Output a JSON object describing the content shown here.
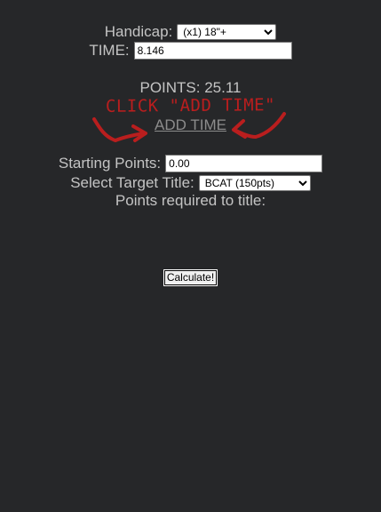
{
  "handicap": {
    "label": "Handicap:",
    "selected": "(x1) 18\"+"
  },
  "time": {
    "label": "TIME:",
    "value": "8.146"
  },
  "points": {
    "label": "POINTS: 25.11"
  },
  "hint": {
    "text": "CLICK \"ADD TIME\"",
    "color": "#b91e1e"
  },
  "add_time": {
    "label": "ADD TIME"
  },
  "starting_points": {
    "label": "Starting Points:",
    "value": "0.00"
  },
  "target_title": {
    "label": "Select Target Title:",
    "selected": "BCAT (150pts)"
  },
  "points_required": {
    "label": "Points required to title:"
  },
  "calculate": {
    "label": "Calculate!"
  },
  "colors": {
    "background": "#262729",
    "text": "#c4c4c4",
    "link": "#8c8c8c",
    "annotation": "#b91e1e"
  }
}
